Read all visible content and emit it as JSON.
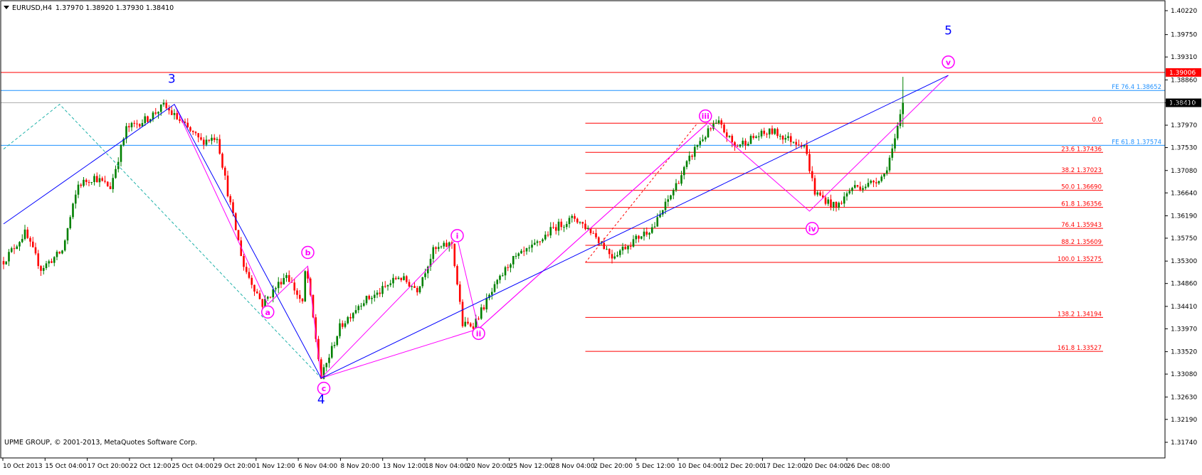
{
  "header": {
    "symbol_label": "EURUSD,H4",
    "ohlc_label": "1.37970 1.38920 1.37930 1.38410"
  },
  "copyright": "UPME GROUP, © 2001-2013, MetaQuotes Software Corp.",
  "colors": {
    "bull": "#008000",
    "bear": "#ff0000",
    "fib": "#ff0000",
    "fe": "#1e90ff",
    "wave_major": "#0000ff",
    "wave_minor": "#ff00ff",
    "channel": "#20b2aa"
  },
  "chart_data": {
    "type": "candlestick",
    "symbol": "EURUSD",
    "timeframe": "H4",
    "ylim": [
      1.3161,
      1.4024
    ],
    "y_ticks": [
      "1.40220",
      "1.39750",
      "1.39310",
      "1.38860",
      "1.38410",
      "1.37970",
      "1.37530",
      "1.37080",
      "1.36640",
      "1.36190",
      "1.35750",
      "1.35300",
      "1.34860",
      "1.34410",
      "1.33970",
      "1.33520",
      "1.33080",
      "1.32630",
      "1.32190",
      "1.31740"
    ],
    "x_labels": [
      "10 Oct 2013",
      "15 Oct 04:00",
      "17 Oct 20:00",
      "22 Oct 12:00",
      "25 Oct 04:00",
      "29 Oct 20:00",
      "1 Nov 12:00",
      "6 Nov 04:00",
      "8 Nov 20:00",
      "13 Nov 12:00",
      "18 Nov 04:00",
      "20 Nov 20:00",
      "25 Nov 12:00",
      "28 Nov 04:00",
      "2 Dec 20:00",
      "5 Dec 12:00",
      "10 Dec 04:00",
      "12 Dec 20:00",
      "17 Dec 12:00",
      "20 Dec 04:00",
      "26 Dec 08:00"
    ],
    "current_price": "1.38410",
    "path_points": [
      {
        "bar": 0,
        "price": 1.353
      },
      {
        "bar": 8,
        "price": 1.3585
      },
      {
        "bar": 14,
        "price": 1.3515
      },
      {
        "bar": 22,
        "price": 1.355
      },
      {
        "bar": 28,
        "price": 1.368
      },
      {
        "bar": 34,
        "price": 1.3695
      },
      {
        "bar": 40,
        "price": 1.3675
      },
      {
        "bar": 46,
        "price": 1.379
      },
      {
        "bar": 54,
        "price": 1.381
      },
      {
        "bar": 60,
        "price": 1.3835
      },
      {
        "bar": 66,
        "price": 1.3805
      },
      {
        "bar": 74,
        "price": 1.3765
      },
      {
        "bar": 80,
        "price": 1.3775
      },
      {
        "bar": 84,
        "price": 1.3665
      },
      {
        "bar": 90,
        "price": 1.352
      },
      {
        "bar": 97,
        "price": 1.3445
      },
      {
        "bar": 106,
        "price": 1.3505
      },
      {
        "bar": 112,
        "price": 1.3445
      },
      {
        "bar": 112,
        "price": 1.352
      },
      {
        "bar": 114,
        "price": 1.3495
      },
      {
        "bar": 119,
        "price": 1.33
      },
      {
        "bar": 126,
        "price": 1.34
      },
      {
        "bar": 134,
        "price": 1.345
      },
      {
        "bar": 140,
        "price": 1.3465
      },
      {
        "bar": 148,
        "price": 1.35
      },
      {
        "bar": 155,
        "price": 1.3475
      },
      {
        "bar": 161,
        "price": 1.355
      },
      {
        "bar": 168,
        "price": 1.3565
      },
      {
        "bar": 172,
        "price": 1.3405
      },
      {
        "bar": 176,
        "price": 1.3405
      },
      {
        "bar": 182,
        "price": 1.346
      },
      {
        "bar": 190,
        "price": 1.353
      },
      {
        "bar": 198,
        "price": 1.3555
      },
      {
        "bar": 206,
        "price": 1.3595
      },
      {
        "bar": 214,
        "price": 1.3615
      },
      {
        "bar": 221,
        "price": 1.3585
      },
      {
        "bar": 228,
        "price": 1.354
      },
      {
        "bar": 236,
        "price": 1.357
      },
      {
        "bar": 244,
        "price": 1.36
      },
      {
        "bar": 252,
        "price": 1.368
      },
      {
        "bar": 260,
        "price": 1.376
      },
      {
        "bar": 266,
        "price": 1.3795
      },
      {
        "bar": 268,
        "price": 1.38
      },
      {
        "bar": 274,
        "price": 1.3755
      },
      {
        "bar": 282,
        "price": 1.3775
      },
      {
        "bar": 288,
        "price": 1.3785
      },
      {
        "bar": 294,
        "price": 1.377
      },
      {
        "bar": 300,
        "price": 1.376
      },
      {
        "bar": 304,
        "price": 1.3665
      },
      {
        "bar": 312,
        "price": 1.3635
      },
      {
        "bar": 318,
        "price": 1.3675
      },
      {
        "bar": 324,
        "price": 1.368
      },
      {
        "bar": 330,
        "price": 1.37
      },
      {
        "bar": 334,
        "price": 1.3765
      },
      {
        "bar": 337,
        "price": 1.3841
      }
    ],
    "fib_retracement": {
      "bar_start": 218,
      "bar_end": 412,
      "levels": [
        {
          "label": "0.0",
          "price": 1.3801
        },
        {
          "label": "23.6 1.37436",
          "price": 1.37436
        },
        {
          "label": "38.2 1.37023",
          "price": 1.37023
        },
        {
          "label": "50.0 1.36690",
          "price": 1.3669
        },
        {
          "label": "61.8 1.36356",
          "price": 1.36356
        },
        {
          "label": "76.4 1.35943",
          "price": 1.35943
        },
        {
          "label": "88.2 1.35609",
          "price": 1.35609
        },
        {
          "label": "100.0 1.35275",
          "price": 1.35275
        },
        {
          "label": "138.2 1.34194",
          "price": 1.34194
        },
        {
          "label": "161.8 1.33527",
          "price": 1.33527
        }
      ]
    },
    "horizontal_lines": [
      {
        "label": "1.39006",
        "price": 1.39006,
        "color": "#ff0000"
      },
      {
        "label": "FE 76.4 1.38652",
        "price": 1.38652,
        "color": "#1e90ff"
      },
      {
        "label": "FE 61.8 1.37574",
        "price": 1.37574,
        "color": "#1e90ff"
      }
    ],
    "wave_labels_major": [
      {
        "text": "3",
        "bar": 63,
        "price": 1.388
      },
      {
        "text": "4",
        "bar": 119,
        "price": 1.325
      },
      {
        "text": "5",
        "bar": 354,
        "price": 1.3975
      }
    ],
    "wave_labels_minor": [
      {
        "text": "a",
        "bar": 99,
        "price": 1.343
      },
      {
        "text": "b",
        "bar": 114,
        "price": 1.3547
      },
      {
        "text": "c",
        "bar": 120,
        "price": 1.328
      },
      {
        "text": "i",
        "bar": 170,
        "price": 1.358
      },
      {
        "text": "ii",
        "bar": 178,
        "price": 1.3388
      },
      {
        "text": "iii",
        "bar": 263,
        "price": 1.3815
      },
      {
        "text": "iv",
        "bar": 303,
        "price": 1.3594
      },
      {
        "text": "v",
        "bar": 354,
        "price": 1.3921
      }
    ],
    "wave_lines_major": [
      [
        {
          "bar": 0,
          "price": 1.3603
        },
        {
          "bar": 64,
          "price": 1.3838
        },
        {
          "bar": 119,
          "price": 1.33
        },
        {
          "bar": 354,
          "price": 1.3895
        }
      ]
    ],
    "wave_lines_minor": [
      [
        {
          "bar": 64,
          "price": 1.3838
        },
        {
          "bar": 99,
          "price": 1.3445
        },
        {
          "bar": 114,
          "price": 1.352
        },
        {
          "bar": 119,
          "price": 1.33
        },
        {
          "bar": 170,
          "price": 1.3575
        },
        {
          "bar": 178,
          "price": 1.3397
        },
        {
          "bar": 264,
          "price": 1.3802
        },
        {
          "bar": 302,
          "price": 1.3628
        },
        {
          "bar": 354,
          "price": 1.3895
        }
      ],
      [
        {
          "bar": 119,
          "price": 1.33
        },
        {
          "bar": 178,
          "price": 1.3397
        },
        {
          "bar": 264,
          "price": 1.3802
        }
      ]
    ],
    "channel_lines": [
      [
        {
          "bar": 0,
          "price": 1.375
        },
        {
          "bar": 21,
          "price": 1.3838
        },
        {
          "bar": 119,
          "price": 1.33
        }
      ]
    ]
  }
}
